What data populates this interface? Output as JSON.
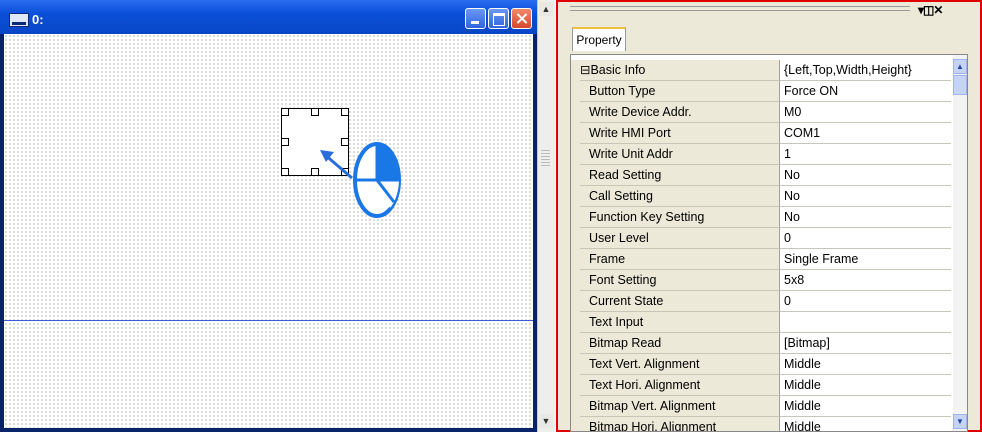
{
  "window": {
    "title": "0:"
  },
  "panel": {
    "tab_label": "Property",
    "toolbar_icons": "▾◫✕",
    "properties": [
      {
        "name": "⊟Basic Info",
        "value": "{Left,Top,Width,Height}"
      },
      {
        "name": "Button Type",
        "value": "Force ON"
      },
      {
        "name": "Write Device Addr.",
        "value": "M0"
      },
      {
        "name": "Write HMI Port",
        "value": "COM1"
      },
      {
        "name": "Write Unit Addr",
        "value": "1"
      },
      {
        "name": "Read Setting",
        "value": "No"
      },
      {
        "name": "Call Setting",
        "value": "No"
      },
      {
        "name": "Function Key Setting",
        "value": "No"
      },
      {
        "name": "User Level",
        "value": "0"
      },
      {
        "name": "Frame",
        "value": "Single Frame"
      },
      {
        "name": "Font Setting",
        "value": "5x8"
      },
      {
        "name": "Current State",
        "value": "0"
      },
      {
        "name": "Text Input",
        "value": ""
      },
      {
        "name": "Bitmap Read",
        "value": "[Bitmap]"
      },
      {
        "name": "Text Vert. Alignment",
        "value": "Middle"
      },
      {
        "name": "Text Hori. Alignment",
        "value": "Middle"
      },
      {
        "name": "Bitmap Vert. Alignment",
        "value": "Middle"
      },
      {
        "name": "Bitmap Hori. Alignment",
        "value": "Middle"
      }
    ]
  },
  "colors": {
    "highlight_border": "#e00000",
    "titlebar": "#0b4fd8",
    "mouse_blue": "#1a78e6"
  },
  "icons": {
    "window_icon": "screen-icon",
    "mouse": "mouse-click-icon",
    "arrow": "arrow-icon"
  }
}
